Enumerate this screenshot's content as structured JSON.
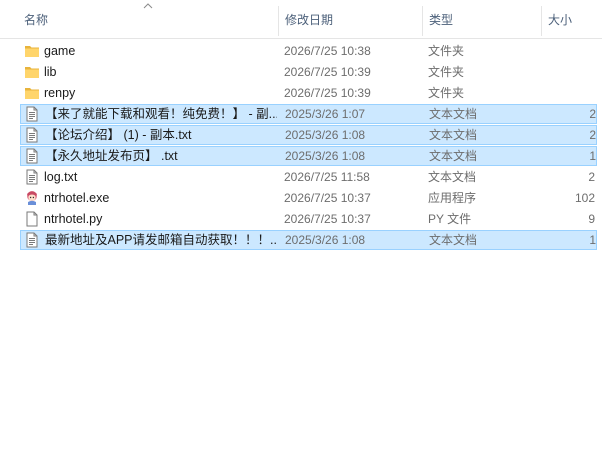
{
  "columns": {
    "name": "名称",
    "date": "修改日期",
    "type": "类型",
    "size": "大小"
  },
  "files": [
    {
      "name": "game",
      "date": "2026/7/25 10:38",
      "type": "文件夹",
      "size": "",
      "icon": "folder-icon",
      "selected": false
    },
    {
      "name": "lib",
      "date": "2026/7/25 10:39",
      "type": "文件夹",
      "size": "",
      "icon": "folder-icon",
      "selected": false
    },
    {
      "name": "renpy",
      "date": "2026/7/25 10:39",
      "type": "文件夹",
      "size": "",
      "icon": "folder-icon",
      "selected": false
    },
    {
      "name": "【来了就能下载和观看！纯免费！】 - 副...",
      "date": "2025/3/26 1:07",
      "type": "文本文档",
      "size": "2",
      "icon": "text-file-icon",
      "selected": true
    },
    {
      "name": "【论坛介绍】 (1) - 副本.txt",
      "date": "2025/3/26 1:08",
      "type": "文本文档",
      "size": "2",
      "icon": "text-file-icon",
      "selected": true
    },
    {
      "name": "【永久地址发布页】 .txt",
      "date": "2025/3/26 1:08",
      "type": "文本文档",
      "size": "1",
      "icon": "text-file-icon",
      "selected": true
    },
    {
      "name": "log.txt",
      "date": "2026/7/25 11:58",
      "type": "文本文档",
      "size": "2",
      "icon": "text-file-icon",
      "selected": false
    },
    {
      "name": "ntrhotel.exe",
      "date": "2026/7/25 10:37",
      "type": "应用程序",
      "size": "102",
      "icon": "app-character-icon",
      "selected": false
    },
    {
      "name": "ntrhotel.py",
      "date": "2026/7/25 10:37",
      "type": "PY 文件",
      "size": "9",
      "icon": "blank-file-icon",
      "selected": false
    },
    {
      "name": "最新地址及APP请发邮箱自动获取！！！...",
      "date": "2025/3/26 1:08",
      "type": "文本文档",
      "size": "1",
      "icon": "text-file-icon",
      "selected": true
    }
  ],
  "colors": {
    "selection_fill": "#cce8ff",
    "selection_border": "#99d1ff",
    "header_text": "#4c607a",
    "folder": "#ffd56b"
  }
}
